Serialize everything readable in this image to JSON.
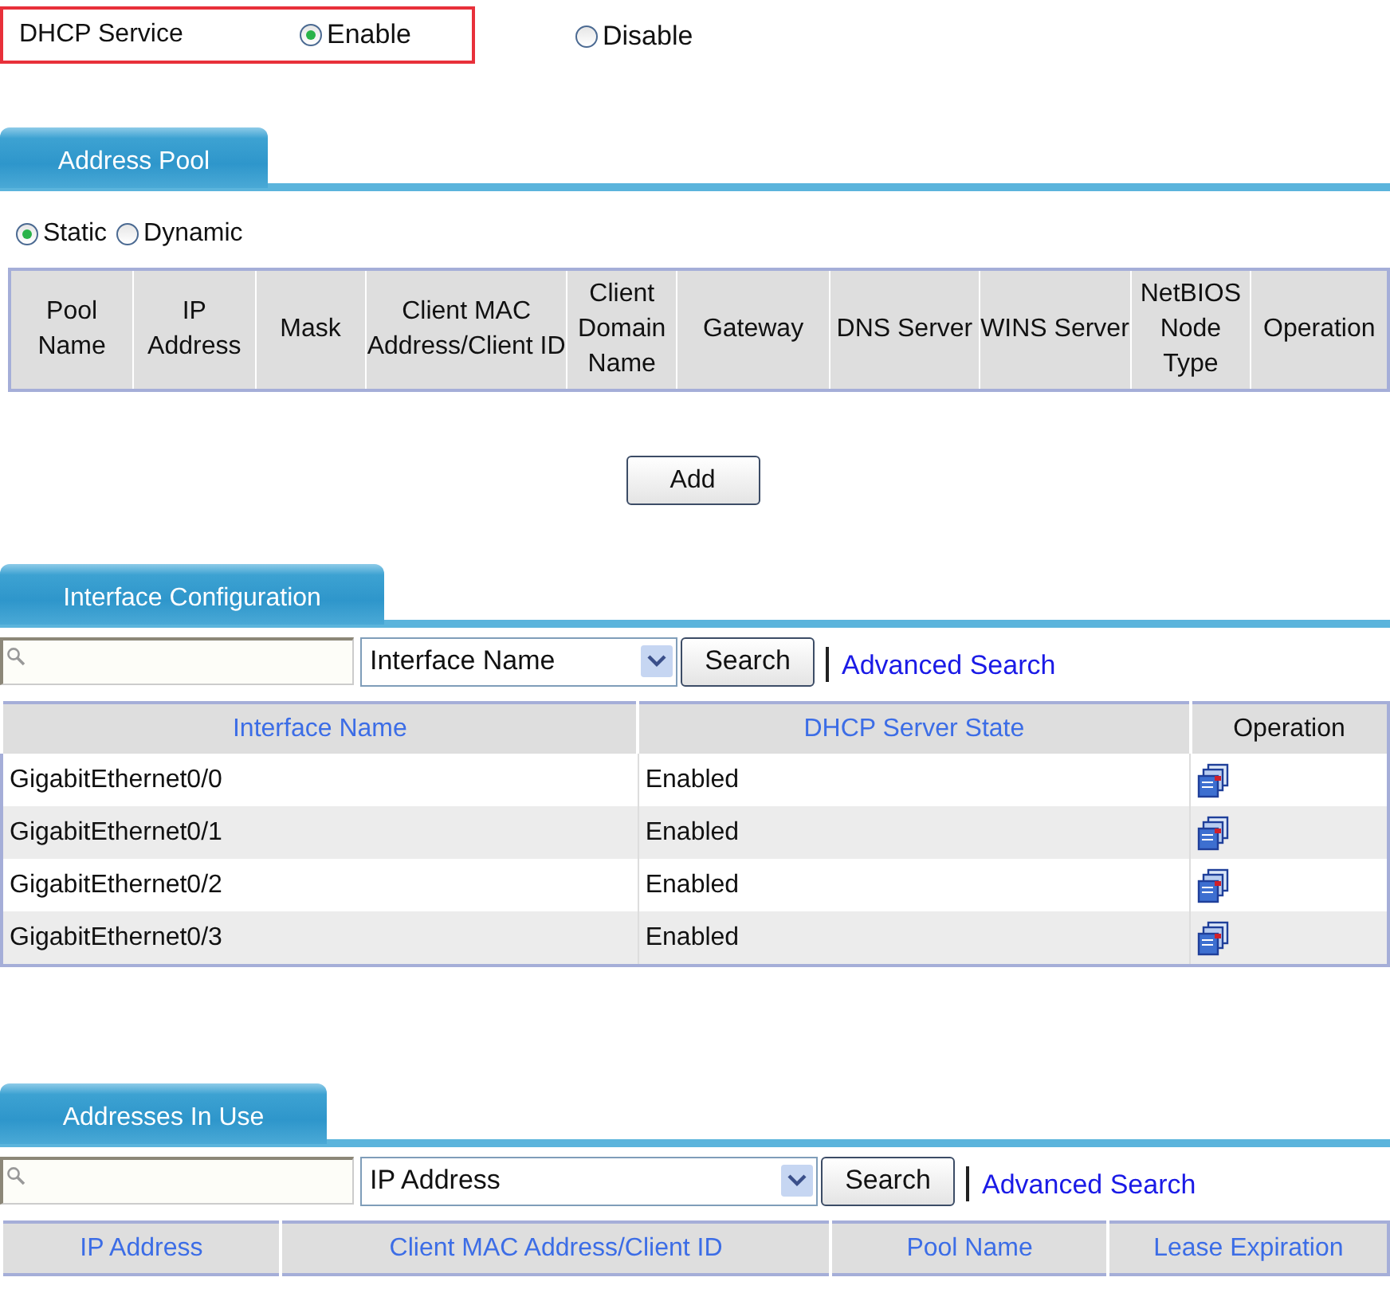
{
  "dhcp_service": {
    "label": "DHCP Service",
    "highlighted": true,
    "options": [
      {
        "label": "Enable",
        "selected": true
      },
      {
        "label": "Disable",
        "selected": false
      }
    ]
  },
  "address_pool": {
    "tab": "Address Pool",
    "mode_options": [
      {
        "label": "Static",
        "selected": true
      },
      {
        "label": "Dynamic",
        "selected": false
      }
    ],
    "table": {
      "columns": [
        "Pool Name",
        "IP Address",
        "Mask",
        "Client MAC Address/Client ID",
        "Client Domain Name",
        "Gateway",
        "DNS Server",
        "WINS Server",
        "NetBIOS Node Type",
        "Operation"
      ]
    },
    "add_button": "Add"
  },
  "interface_configuration": {
    "tab": "Interface Configuration",
    "search": {
      "filter": "Interface Name",
      "button": "Search",
      "advanced_link": "Advanced Search"
    },
    "table": {
      "columns": [
        {
          "label": "Interface Name",
          "sortable": true
        },
        {
          "label": "DHCP Server State",
          "sortable": true
        },
        {
          "label": "Operation",
          "sortable": false
        }
      ],
      "rows": [
        {
          "interface": "GigabitEthernet0/0",
          "state": "Enabled"
        },
        {
          "interface": "GigabitEthernet0/1",
          "state": "Enabled"
        },
        {
          "interface": "GigabitEthernet0/2",
          "state": "Enabled"
        },
        {
          "interface": "GigabitEthernet0/3",
          "state": "Enabled"
        }
      ]
    }
  },
  "addresses_in_use": {
    "tab": "Addresses In Use",
    "search": {
      "filter": "IP Address",
      "button": "Search",
      "advanced_link": "Advanced Search"
    },
    "table": {
      "columns": [
        {
          "label": "IP Address",
          "sortable": true
        },
        {
          "label": "Client MAC Address/Client ID",
          "sortable": true
        },
        {
          "label": "Pool Name",
          "sortable": true
        },
        {
          "label": "Lease Expiration",
          "sortable": true
        }
      ]
    }
  }
}
